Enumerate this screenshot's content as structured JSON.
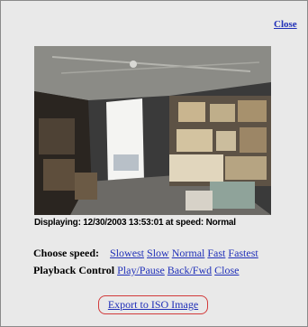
{
  "header": {
    "close_label": "Close"
  },
  "video": {
    "caption": "Displaying: 12/30/2003 13:53:01 at speed: Normal"
  },
  "speed": {
    "label": "Choose speed:",
    "options": [
      "Slowest",
      "Slow",
      "Normal",
      "Fast",
      "Fastest"
    ]
  },
  "playback": {
    "label": "Playback Control",
    "links": [
      "Play/Pause",
      "Back/Fwd",
      "Close"
    ]
  },
  "export": {
    "label": "Export to ISO Image"
  },
  "colors": {
    "link": "#1f2fb8",
    "highlight": "#d23a3a",
    "panel": "#e9e9e9"
  }
}
